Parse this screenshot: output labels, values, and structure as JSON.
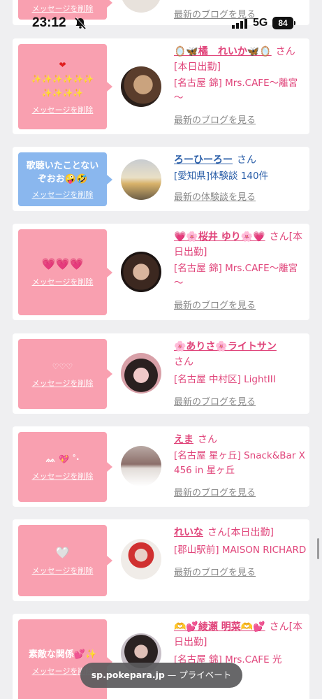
{
  "status_bar": {
    "time": "23:12",
    "network": "5G",
    "battery": "84"
  },
  "url_bar": {
    "domain": "sp.pokepara.jp",
    "suffix": " — プライベート"
  },
  "top_partial": {
    "link": "最新のブログを見る",
    "delete": "メッセージを削除"
  },
  "cards": [
    {
      "message": "❤️\n✨✨✨✨✨✨\n✨✨✨✨",
      "delete": "メッセージを削除",
      "name": "🪞🦋橘　れいか🦋🪞",
      "san": "さん",
      "status": "[本日出勤]",
      "shop": "[名古屋 錦] Mrs.CAFE～離宮～",
      "link": "最新のブログを見る"
    },
    {
      "message": "歌聴いたことない\nぞおお🤪🤣",
      "delete": "メッセージを削除",
      "name": "ろーひーろー",
      "san": "さん",
      "status": "",
      "shop": "[愛知県]体験談 140件",
      "link": "最新の体験談を見る"
    },
    {
      "message": "💗💗💗",
      "delete": "メッセージを削除",
      "name": "💗🌸桜井 ゆり🌸💗",
      "san": "さん",
      "status": "[本日出勤]",
      "shop": "[名古屋 錦] Mrs.CAFE～離宮～",
      "link": "最新のブログを見る"
    },
    {
      "message": "♡♡♡",
      "delete": "メッセージを削除",
      "name": "🌸ありさ🌸ライトサン",
      "san": "さん",
      "status": "",
      "shop": "[名古屋 中村区] LightIII",
      "link": "最新のブログを見る"
    },
    {
      "message": "ᨐ 💖 ˚‧",
      "delete": "メッセージを削除",
      "name": "えま",
      "san": "さん",
      "status": "",
      "shop": "[名古屋 星ヶ丘] Snack&Bar X 456 in 星ヶ丘",
      "link": "最新のブログを見る"
    },
    {
      "message": "🤍",
      "delete": "メッセージを削除",
      "name": "れいな",
      "san": "さん",
      "status": "[本日出勤]",
      "shop": "[郡山駅前] MAISON RICHARD",
      "link": "最新のブログを見る"
    },
    {
      "message": "素敵な関係💕✨",
      "delete": "メッセージを削除",
      "name": "🫶💕綾瀬 明菜🫶💕",
      "san": "さん",
      "status": "[本日出勤]",
      "shop": "[名古屋 錦] Mrs.CAFE 光",
      "link": ""
    }
  ],
  "colors": {
    "pink_bubble": "#f9a0b0",
    "blue_bubble": "#8ab7ee",
    "name_pink": "#e0447a",
    "name_blue": "#2a5ea8"
  }
}
